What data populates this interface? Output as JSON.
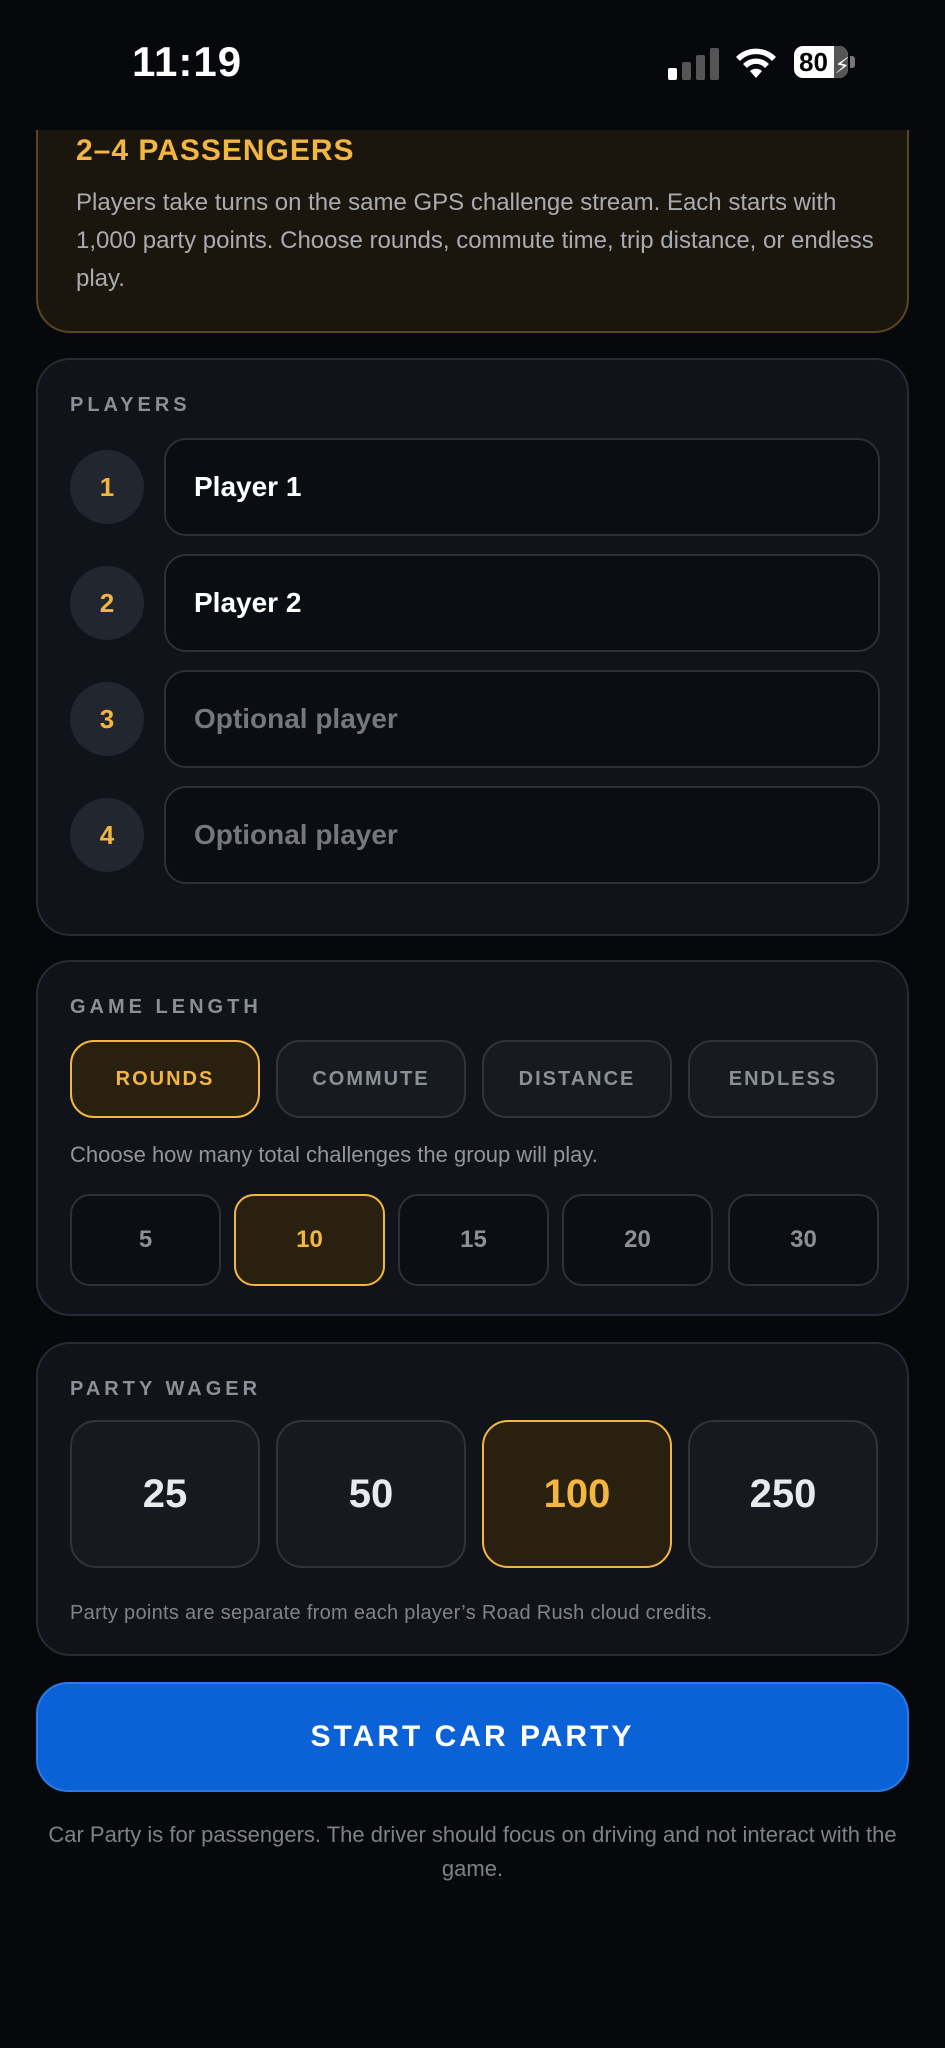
{
  "status": {
    "time": "11:19",
    "battery": "80"
  },
  "info": {
    "title": "2–4 PASSENGERS",
    "text": "Players take turns on the same GPS challenge stream. Each starts with 1,000 party points. Choose rounds, commute time, trip distance, or endless play."
  },
  "players": {
    "label": "PLAYERS",
    "items": [
      {
        "num": "1",
        "value": "Player 1",
        "placeholder": "Optional player"
      },
      {
        "num": "2",
        "value": "Player 2",
        "placeholder": "Optional player"
      },
      {
        "num": "3",
        "value": "",
        "placeholder": "Optional player"
      },
      {
        "num": "4",
        "value": "",
        "placeholder": "Optional player"
      }
    ]
  },
  "game_length": {
    "label": "GAME LENGTH",
    "modes": [
      "ROUNDS",
      "COMMUTE",
      "DISTANCE",
      "ENDLESS"
    ],
    "selected_mode": "ROUNDS",
    "hint": "Choose how many total challenges the group will play.",
    "rounds": [
      "5",
      "10",
      "15",
      "20",
      "30"
    ],
    "selected_round": "10"
  },
  "wager": {
    "label": "PARTY WAGER",
    "options": [
      "25",
      "50",
      "100",
      "250"
    ],
    "selected": "100",
    "note": "Party points are separate from each player’s Road Rush cloud credits."
  },
  "start_button": "START CAR PARTY",
  "footer": "Car Party is for passengers. The driver should focus on driving and not interact with the game.",
  "colors": {
    "accent": "#f3b641",
    "primary": "#0a62d6",
    "background": "#06080c"
  }
}
